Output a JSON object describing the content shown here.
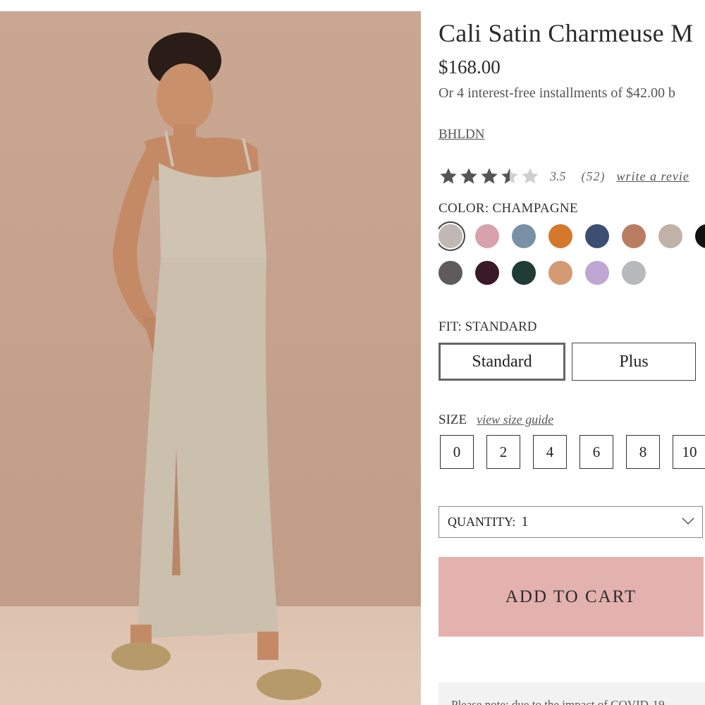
{
  "product": {
    "title": "Cali Satin Charmeuse M",
    "price": "$168.00",
    "installments": "Or 4 interest-free installments of $42.00 b",
    "brand": "BHLDN"
  },
  "rating": {
    "stars": 3.5,
    "value": "3.5",
    "count": "(52)",
    "write_review": "write a revie"
  },
  "color": {
    "label": "COLOR: CHAMPAGNE",
    "swatches_row1": [
      "#c2b8b3",
      "#d8a2ad",
      "#7991a7",
      "#d4782b",
      "#3d4e73",
      "#bb7d61",
      "#c0b2a8",
      "#111111"
    ],
    "swatches_row2": [
      "#5f5b5c",
      "#3a1a28",
      "#1f3c35",
      "#d49a73",
      "#bfa6d3",
      "#b8b9bb"
    ],
    "selected_index": 0
  },
  "fit": {
    "label": "FIT: STANDARD",
    "options": [
      "Standard",
      "Plus"
    ]
  },
  "size": {
    "label": "SIZE",
    "guide_link": "view size guide",
    "options": [
      "0",
      "2",
      "4",
      "6",
      "8",
      "10"
    ]
  },
  "quantity": {
    "label": "QUANTITY:",
    "value": "1"
  },
  "cart_button": "ADD TO CART",
  "notice": "Please note: due to the impact of COVID-19"
}
